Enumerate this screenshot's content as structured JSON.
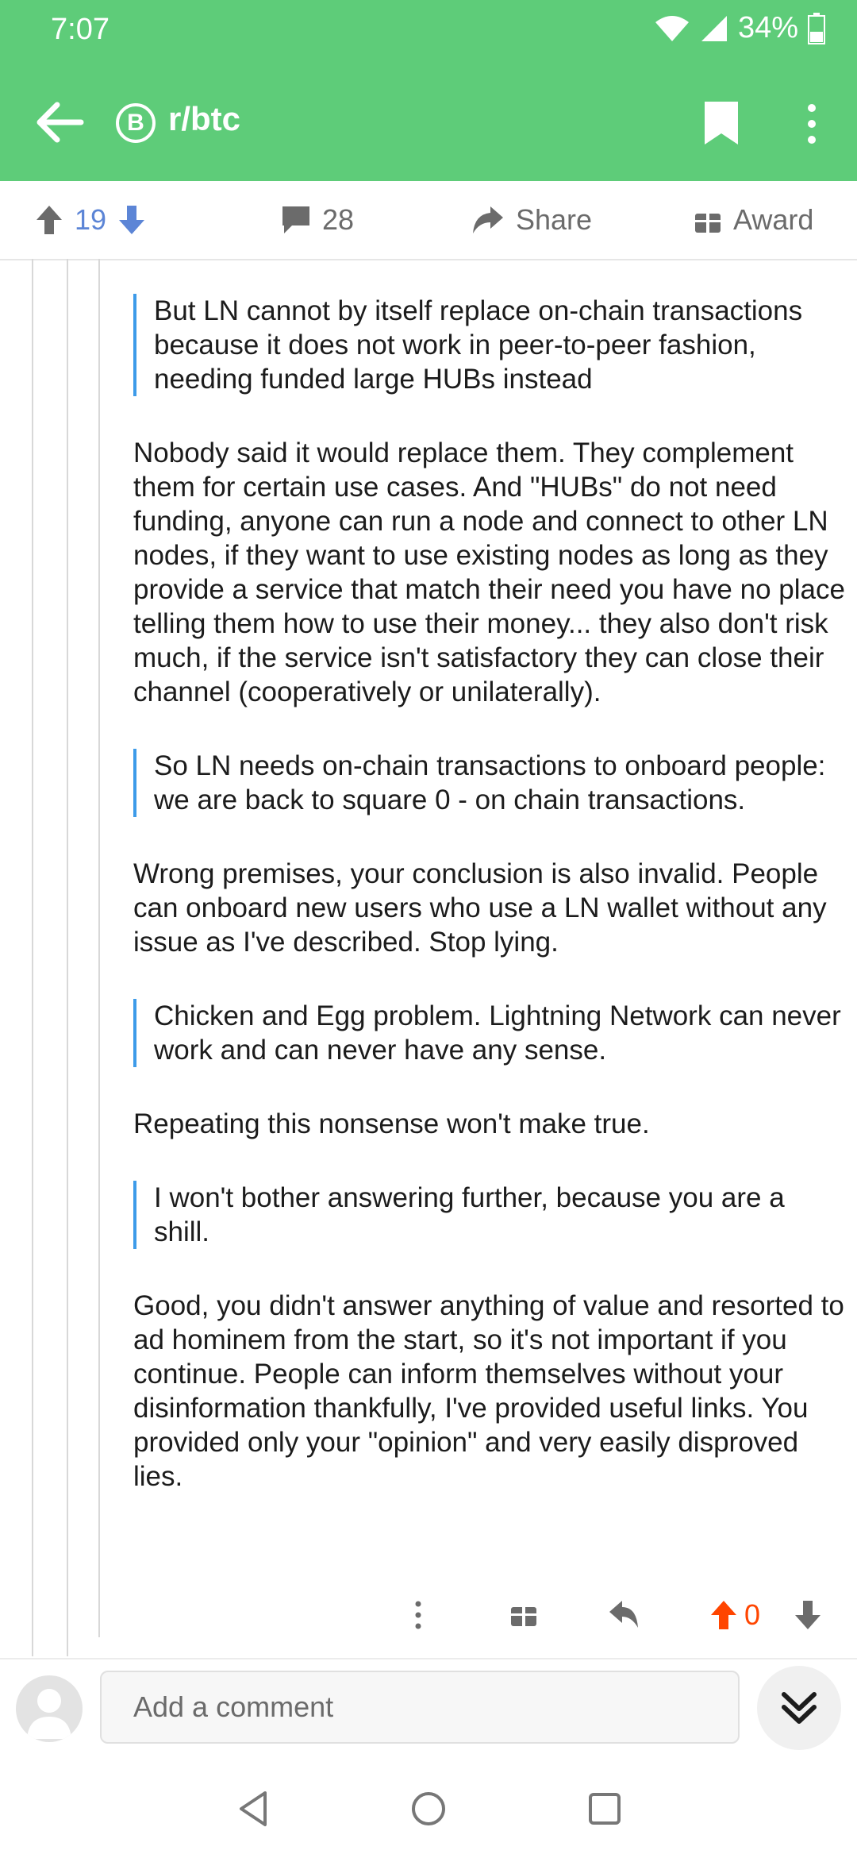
{
  "status": {
    "time": "7:07",
    "battery": "34%"
  },
  "appbar": {
    "subreddit": "r/btc",
    "subreddit_icon_letter": "B"
  },
  "actions": {
    "score": "19",
    "comments": "28",
    "share": "Share",
    "award": "Award"
  },
  "comment": {
    "blocks": [
      {
        "type": "quote",
        "text": "But LN cannot by itself replace on-chain transactions because it does not work in peer-to-peer fashion, needing funded large HUBs instead"
      },
      {
        "type": "para",
        "text": "Nobody said it would replace them. They complement them for certain use cases. And \"HUBs\" do not need funding, anyone can run a node and connect to other LN nodes, if they want to use existing nodes as long as they provide a service that match their need you have no place telling them how to use their money... they also don't risk much, if the service isn't satisfactory they can close their channel (cooperatively or unilaterally)."
      },
      {
        "type": "quote",
        "text": "So LN needs on-chain transactions to onboard people: we are back to square 0 - on chain transactions."
      },
      {
        "type": "para",
        "text": "Wrong premises, your conclusion is also invalid. People can onboard new users who use a LN wallet without any issue as I've described. Stop lying."
      },
      {
        "type": "quote",
        "text": "Chicken and Egg problem. Lightning Network can never work and can never have any sense."
      },
      {
        "type": "para",
        "text": "Repeating this nonsense won't make true."
      },
      {
        "type": "quote",
        "text": "I won't bother answering further, because you are a shill."
      },
      {
        "type": "para",
        "text": "Good, you didn't answer anything of value and resorted to ad hominem from the start, so it's not important if you continue. People can inform themselves without your disinformation thankfully, I've provided useful links. You provided only your \"opinion\" and very easily disproved lies."
      }
    ],
    "score": "0"
  },
  "composer": {
    "placeholder": "Add a comment"
  },
  "colors": {
    "brand_green": "#5ecc79",
    "quote_bar": "#3d9be9",
    "upvote_active": "#ff4500",
    "vote_blue": "#5c85d6"
  },
  "icons": [
    "back-arrow-icon",
    "bitcoin-icon",
    "bookmark-icon",
    "more-vertical-icon",
    "upvote-icon",
    "downvote-icon",
    "comment-icon",
    "share-icon",
    "gift-icon",
    "reply-icon",
    "double-chevron-down-icon"
  ]
}
